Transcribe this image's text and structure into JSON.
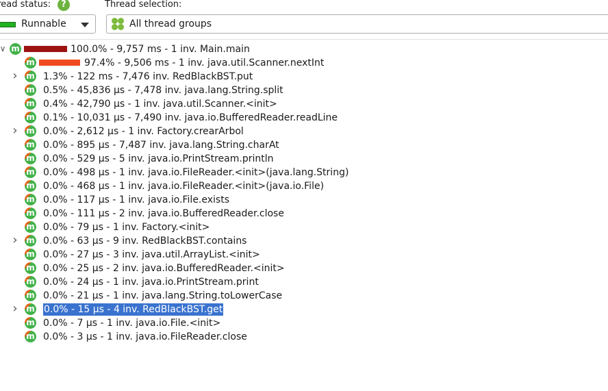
{
  "toolbar": {
    "thread_status_label": "hread status:",
    "thread_status_value": "Runnable",
    "thread_selection_label": "Thread selection:",
    "thread_selection_value": "All thread groups",
    "help_glyph": "?"
  },
  "colors": {
    "runnable_swatch": "#21b121",
    "bar_root": "#9e1212",
    "bar_child": "#f04a1f",
    "selection": "#3a73cf",
    "method_icon": "#42b24a"
  },
  "tree": {
    "root": {
      "text": "100.0% - 9,757 ms - 1 inv. Main.main",
      "bar_fraction": 1.0,
      "expanded": true
    },
    "rows": [
      {
        "text": "97.4% - 9,506 ms - 1 inv. java.util.Scanner.nextInt",
        "bar_fraction": 0.974,
        "expandable": false
      },
      {
        "text": "1.3% - 122 ms - 7,476 inv. RedBlackBST.put",
        "expandable": true
      },
      {
        "text": "0.5% - 45,836 µs - 7,478 inv. java.lang.String.split",
        "expandable": false
      },
      {
        "text": "0.4% - 42,790 µs - 1 inv. java.util.Scanner.<init>",
        "expandable": false
      },
      {
        "text": "0.1% - 10,031 µs - 7,490 inv. java.io.BufferedReader.readLine",
        "expandable": false
      },
      {
        "text": "0.0% - 2,612 µs - 1 inv. Factory.crearArbol",
        "expandable": true
      },
      {
        "text": "0.0% - 895 µs - 7,487 inv. java.lang.String.charAt",
        "expandable": false
      },
      {
        "text": "0.0% - 529 µs - 5 inv. java.io.PrintStream.println",
        "expandable": false
      },
      {
        "text": "0.0% - 498 µs - 1 inv. java.io.FileReader.<init>(java.lang.String)",
        "expandable": false
      },
      {
        "text": "0.0% - 468 µs - 1 inv. java.io.FileReader.<init>(java.io.File)",
        "expandable": false
      },
      {
        "text": "0.0% - 117 µs - 1 inv. java.io.File.exists",
        "expandable": false
      },
      {
        "text": "0.0% - 111 µs - 2 inv. java.io.BufferedReader.close",
        "expandable": false
      },
      {
        "text": "0.0% - 79 µs - 1 inv. Factory.<init>",
        "expandable": false
      },
      {
        "text": "0.0% - 63 µs - 9 inv. RedBlackBST.contains",
        "expandable": true
      },
      {
        "text": "0.0% - 27 µs - 3 inv. java.util.ArrayList.<init>",
        "expandable": false
      },
      {
        "text": "0.0% - 25 µs - 2 inv. java.io.BufferedReader.<init>",
        "expandable": false
      },
      {
        "text": "0.0% - 24 µs - 1 inv. java.io.PrintStream.print",
        "expandable": false
      },
      {
        "text": "0.0% - 21 µs - 1 inv. java.lang.String.toLowerCase",
        "expandable": false
      },
      {
        "text": "0.0% - 15 µs - 4 inv. RedBlackBST.get",
        "expandable": true,
        "selected": true
      },
      {
        "text": "0.0% - 7 µs - 1 inv. java.io.File.<init>",
        "expandable": false
      },
      {
        "text": "0.0% - 3 µs - 1 inv. java.io.FileReader.close",
        "expandable": false
      }
    ]
  }
}
